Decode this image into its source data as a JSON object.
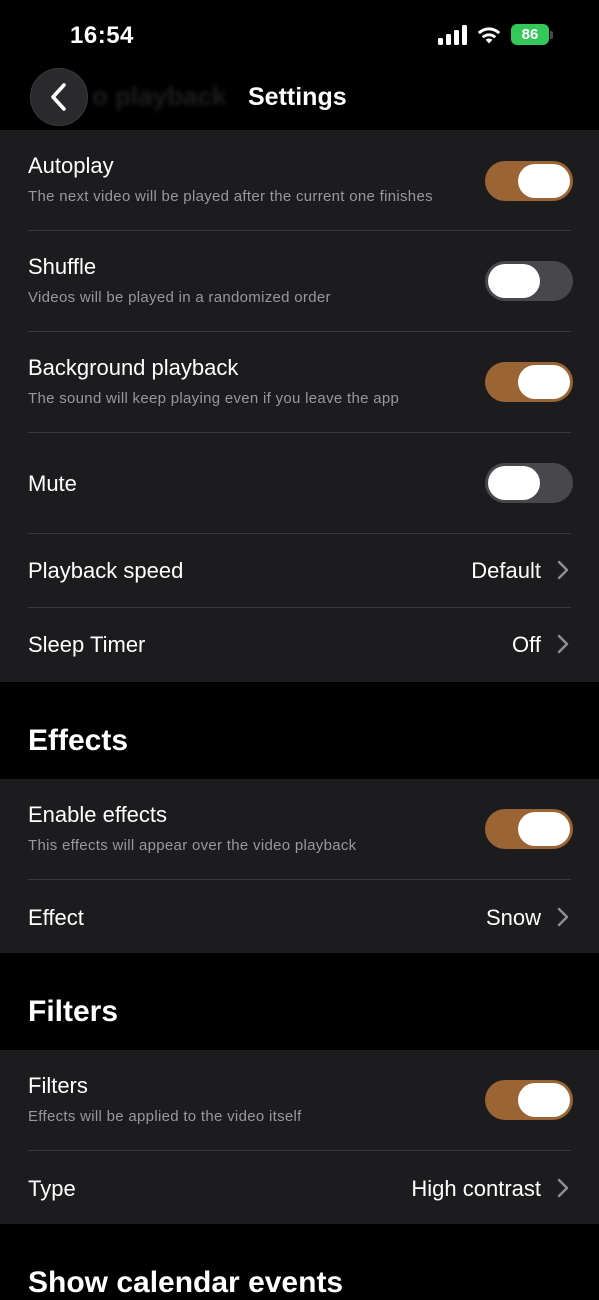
{
  "status_bar": {
    "time": "16:54",
    "battery": "86",
    "battery_color": "#34c759"
  },
  "nav": {
    "back_icon": "chevron-left-icon",
    "ghost_title": "o playback",
    "title": "Settings"
  },
  "colors": {
    "toggle_on": "#9b6434",
    "toggle_off": "#48484c",
    "group_bg": "#1c1c1e"
  },
  "playback": {
    "autoplay": {
      "title": "Autoplay",
      "subtitle": "The next video will be played after the current one finishes",
      "enabled": true
    },
    "shuffle": {
      "title": "Shuffle",
      "subtitle": "Videos will be played in a randomized order",
      "enabled": false
    },
    "background": {
      "title": "Background playback",
      "subtitle": "The sound will keep playing even if you leave the app",
      "enabled": true
    },
    "mute": {
      "title": "Mute",
      "enabled": false
    },
    "speed": {
      "title": "Playback speed",
      "value": "Default"
    },
    "sleep": {
      "title": "Sleep Timer",
      "value": "Off"
    }
  },
  "effects": {
    "header": "Effects",
    "enable": {
      "title": "Enable effects",
      "subtitle": "This effects will appear over the video playback",
      "enabled": true
    },
    "effect": {
      "title": "Effect",
      "value": "Snow"
    }
  },
  "filters": {
    "header": "Filters",
    "enable": {
      "title": "Filters",
      "subtitle": "Effects will be applied to the video itself",
      "enabled": true
    },
    "type": {
      "title": "Type",
      "value": "High contrast"
    }
  },
  "calendar": {
    "header": "Show calendar events"
  }
}
